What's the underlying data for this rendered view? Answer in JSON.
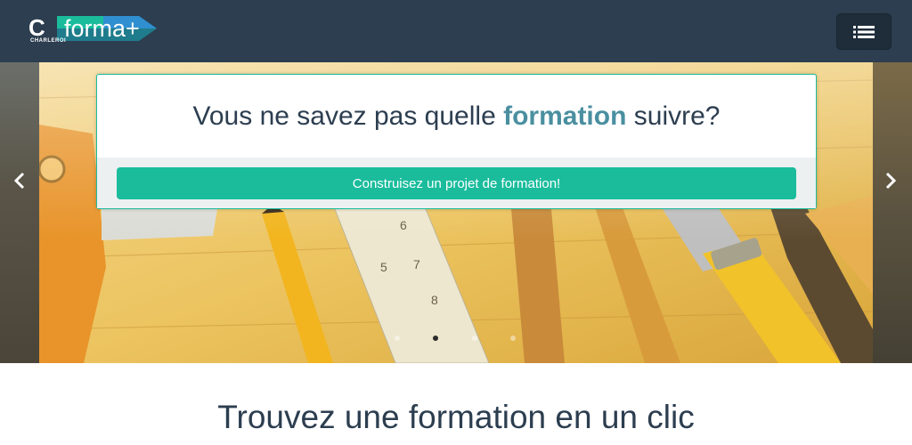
{
  "navbar": {
    "logo": {
      "letter": "C",
      "subtitle": "CHARLEROI",
      "brand": "forma+"
    },
    "menu_icon": "list-icon"
  },
  "carousel": {
    "prev_icon": "chevron-left-icon",
    "next_icon": "chevron-right-icon",
    "slide_count": 4,
    "active_slide": 2
  },
  "caption": {
    "heading_before": "Vous ne savez pas quelle ",
    "heading_highlight": "formation",
    "heading_after": " suivre?",
    "cta_label": "Construisez un projet de formation!"
  },
  "section": {
    "title": "Trouvez une formation en un clic"
  },
  "colors": {
    "navbar": "#2c3e50",
    "accent": "#1abc9c",
    "highlight": "#4a8fa0",
    "text": "#2c3e50"
  }
}
